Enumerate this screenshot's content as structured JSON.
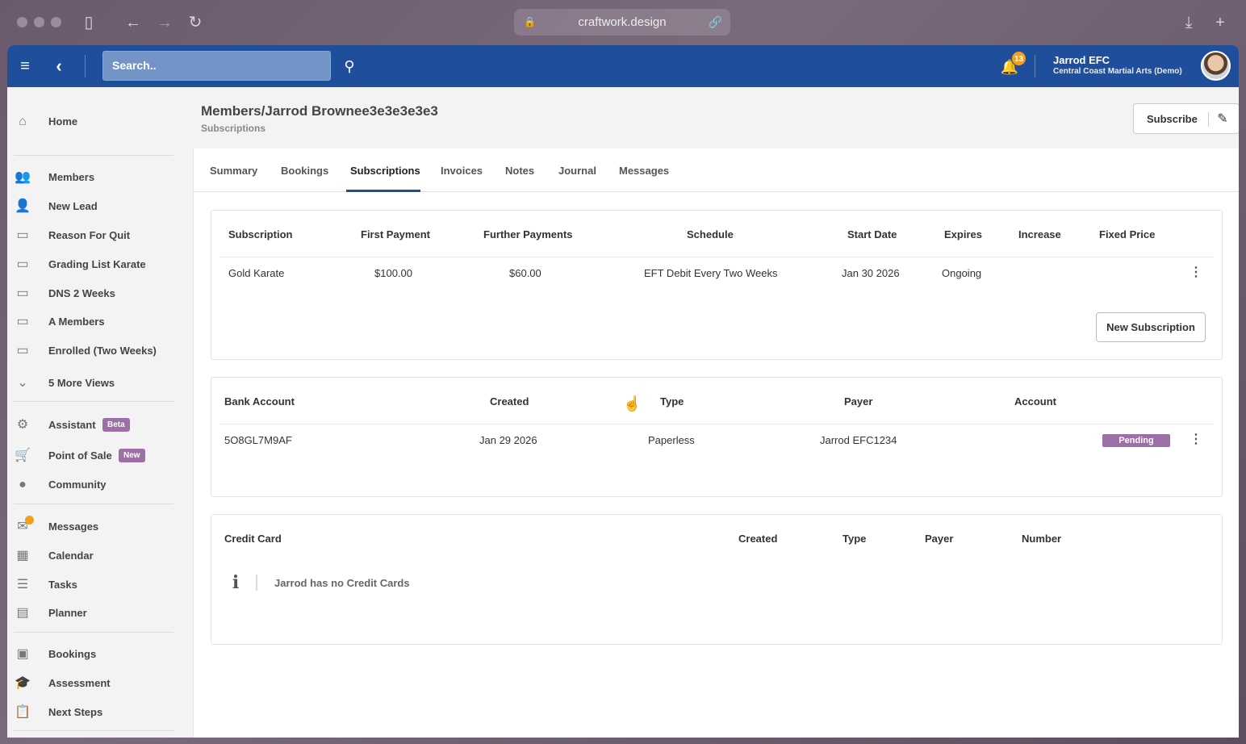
{
  "browser": {
    "url": "craftwork.design"
  },
  "topbar": {
    "search_placeholder": "Search..",
    "notification_count": "13",
    "user_name": "Jarrod EFC",
    "user_org": "Central Coast Martial Arts (Demo)"
  },
  "sidebar": {
    "items": [
      {
        "label": "Home",
        "icon": "home-icon"
      },
      {
        "label": "Members",
        "icon": "users-icon"
      },
      {
        "label": "New Lead",
        "icon": "user-edit-icon"
      },
      {
        "label": "Reason For Quit",
        "icon": "folder-icon"
      },
      {
        "label": "Grading List Karate",
        "icon": "folder-icon"
      },
      {
        "label": "DNS 2 Weeks",
        "icon": "folder-icon"
      },
      {
        "label": "A Members",
        "icon": "folder-icon"
      },
      {
        "label": "Enrolled (Two Weeks)",
        "icon": "folder-icon"
      },
      {
        "label": "5 More Views",
        "icon": "chevron-down-icon"
      },
      {
        "label": "Assistant",
        "icon": "robot-icon",
        "badge": "Beta"
      },
      {
        "label": "Point of Sale",
        "icon": "cart-icon",
        "badge": "New"
      },
      {
        "label": "Community",
        "icon": "community-icon"
      },
      {
        "label": "Messages",
        "icon": "messages-icon"
      },
      {
        "label": "Calendar",
        "icon": "calendar-icon"
      },
      {
        "label": "Tasks",
        "icon": "tasks-icon"
      },
      {
        "label": "Planner",
        "icon": "planner-icon"
      },
      {
        "label": "Bookings",
        "icon": "bookings-icon"
      },
      {
        "label": "Assessment",
        "icon": "graduation-cap-icon"
      },
      {
        "label": "Next Steps",
        "icon": "clipboard-icon"
      }
    ]
  },
  "page": {
    "title": "Members/Jarrod Brownee3e3e3e3e3",
    "subtitle": "Subscriptions",
    "subscribe_label": "Subscribe"
  },
  "tabs": [
    "Summary",
    "Bookings",
    "Subscriptions",
    "Invoices",
    "Notes",
    "Journal",
    "Messages"
  ],
  "subscriptions": {
    "headers": [
      "Subscription",
      "First Payment",
      "Further Payments",
      "Schedule",
      "Start Date",
      "Expires",
      "Increase",
      "Fixed Price"
    ],
    "rows": [
      [
        "Gold Karate",
        "$100.00",
        "$60.00",
        "EFT Debit Every Two Weeks",
        "Jan 30 2026",
        "Ongoing",
        "",
        ""
      ]
    ],
    "new_button": "New Subscription"
  },
  "bank_accounts": {
    "headers": [
      "Bank Account",
      "Created",
      "Type",
      "Payer",
      "Account"
    ],
    "rows": [
      [
        "5O8GL7M9AF",
        "Jan 29 2026",
        "Paperless",
        "Jarrod EFC1234",
        "Pending"
      ]
    ]
  },
  "credit_cards": {
    "headers": [
      "Credit Card",
      "Created",
      "Type",
      "Payer",
      "Number"
    ],
    "empty_message": "Jarrod has no Credit Cards"
  }
}
